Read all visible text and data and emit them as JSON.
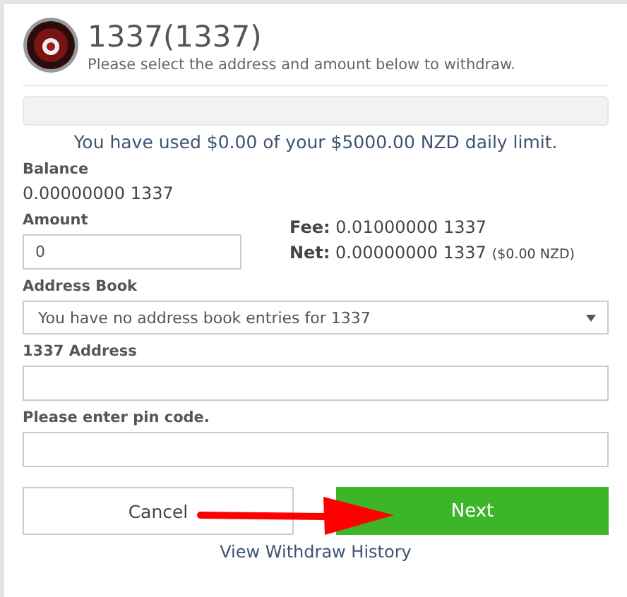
{
  "header": {
    "title": "1337(1337)",
    "subtitle": "Please select the address and amount below to withdraw."
  },
  "limit_text": "You have used $0.00 of your $5000.00 NZD daily limit.",
  "balance": {
    "label": "Balance",
    "value": "0.00000000 1337"
  },
  "amount": {
    "label": "Amount",
    "value": "0"
  },
  "fee": "**Fee:** 0.01000000 1337",
  "net": {
    "text": "**Net:** 0.00000000 1337",
    "fiat": "($0.00 NZD)"
  },
  "address_book": {
    "label": "Address Book",
    "value": "You have no address book entries for 1337"
  },
  "address": {
    "label": "1337 Address"
  },
  "pin": {
    "label": "Please enter pin code."
  },
  "buttons": {
    "cancel": "Cancel",
    "next": "Next"
  },
  "history_link": "View Withdraw History"
}
